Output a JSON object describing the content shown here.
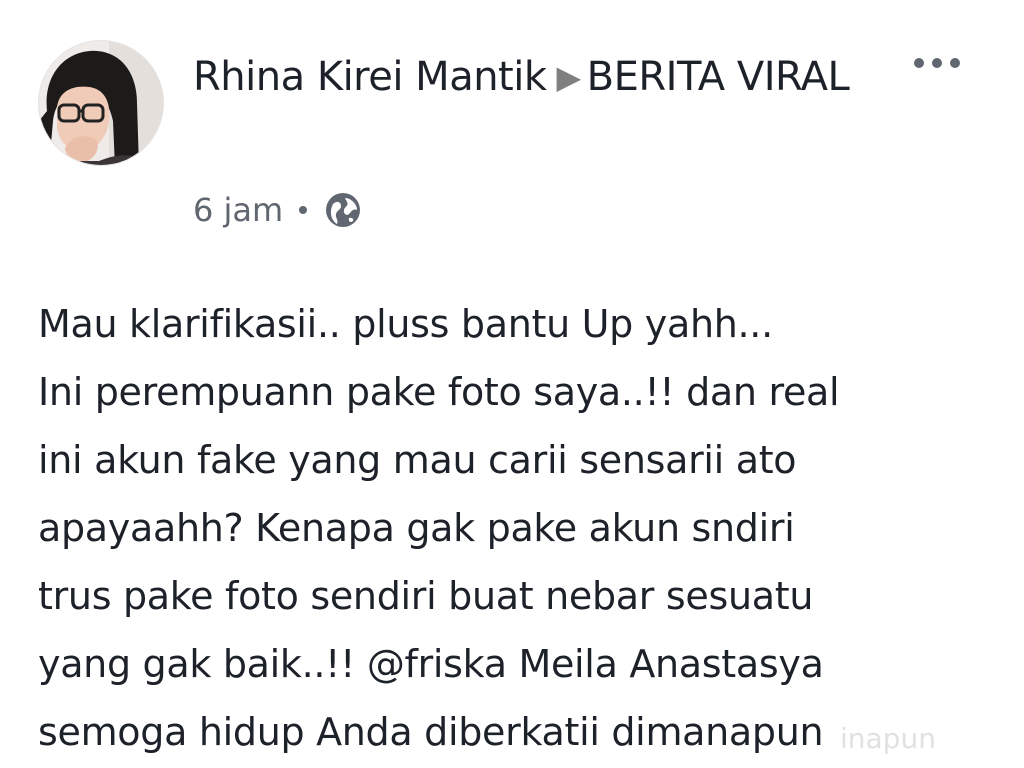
{
  "post": {
    "author": "Rhina Kirei Mantik",
    "arrow": "▶",
    "group": "BERITA VIRAL",
    "time": "6 jam",
    "privacy_icon": "globe-icon",
    "more_icon": "more-options-icon",
    "body": "Mau klarifikasii.. pluss bantu Up yahh...\nIni perempuann pake foto saya..!! dan real\nini akun fake yang mau carii sensarii ato\napayaahh? Kenapa gak pake akun sndiri\ntrus pake foto sendiri buat nebar sesuatu\nyang gak baik..!! @friska Meila Anastasya\nsemoga hidup Anda diberkatii dimanapun"
  },
  "watermark": "inapun",
  "colors": {
    "text": "#1d2129",
    "meta": "#616770",
    "background": "#ffffff"
  }
}
